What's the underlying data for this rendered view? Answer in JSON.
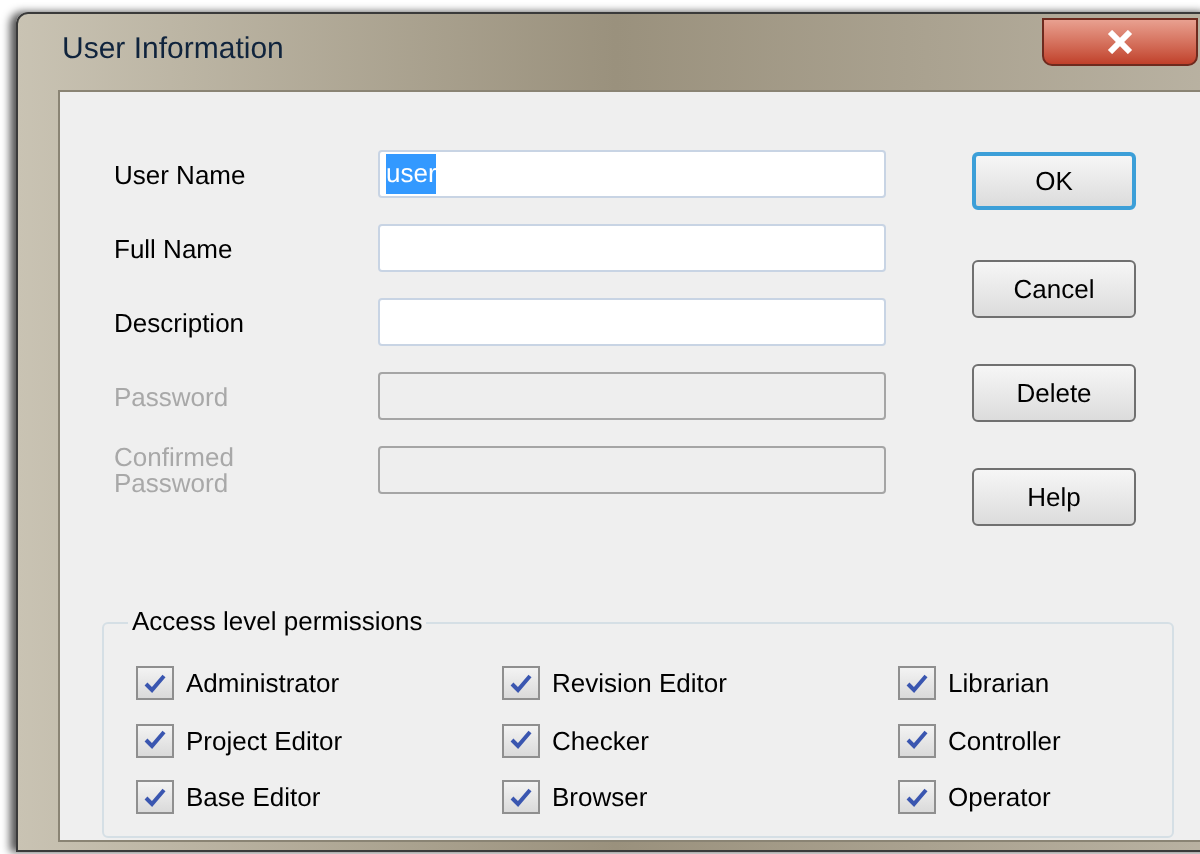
{
  "window": {
    "title": "User Information"
  },
  "fields": [
    {
      "label": "User Name",
      "value": "user",
      "text_selected": true,
      "disabled": false
    },
    {
      "label": "Full Name",
      "disabled": false
    },
    {
      "label": "Description",
      "disabled": false
    },
    {
      "label": "Password",
      "disabled": true
    },
    {
      "label": "Confirmed Password",
      "disabled": true
    }
  ],
  "buttons": [
    {
      "label": "OK",
      "default": true
    },
    {
      "label": "Cancel",
      "default": false
    },
    {
      "label": "Delete",
      "default": false
    },
    {
      "label": "Help",
      "default": false
    }
  ],
  "permissions": {
    "title": "Access level permissions",
    "items": [
      {
        "label": "Administrator",
        "checked": true
      },
      {
        "label": "Revision Editor",
        "checked": true
      },
      {
        "label": "Librarian",
        "checked": true
      },
      {
        "label": "Project Editor",
        "checked": true
      },
      {
        "label": "Checker",
        "checked": true
      },
      {
        "label": "Controller",
        "checked": true
      },
      {
        "label": "Base Editor",
        "checked": true
      },
      {
        "label": "Browser",
        "checked": true
      },
      {
        "label": "Operator",
        "checked": true
      }
    ]
  }
}
